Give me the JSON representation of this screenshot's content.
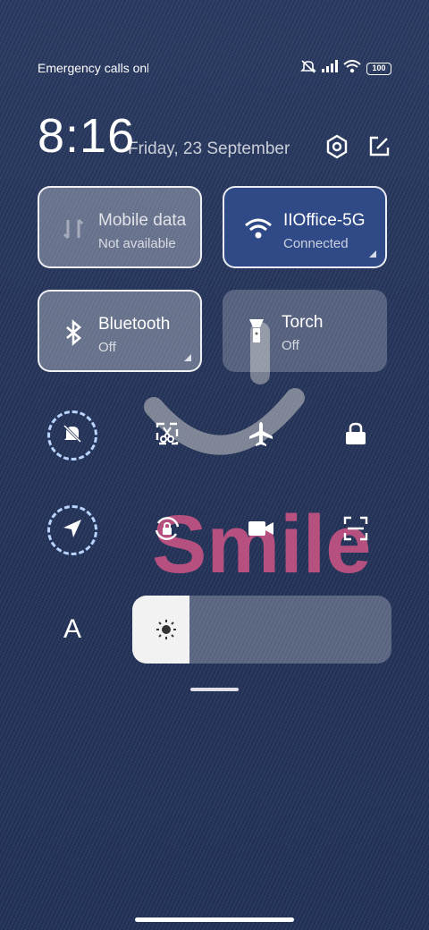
{
  "status_bar": {
    "carrier_text": "Emergency calls only",
    "battery_level": "100",
    "icons": [
      "silent-icon",
      "signal-icon",
      "wifi-icon",
      "battery-icon"
    ]
  },
  "header": {
    "time": "8:16",
    "date": "Friday, 23 September",
    "icons": [
      "settings-icon",
      "edit-icon"
    ]
  },
  "tiles": [
    {
      "name": "Mobile data",
      "status": "Not available",
      "icon": "mobile-data-icon",
      "active": false
    },
    {
      "name": "IIOffice-5G",
      "status": "Connected",
      "icon": "wifi-icon",
      "active": true
    },
    {
      "name": "Bluetooth",
      "status": "Off",
      "icon": "bluetooth-icon",
      "active": false
    },
    {
      "name": "Torch",
      "status": "Off",
      "icon": "torch-icon",
      "active": false
    }
  ],
  "quick_toggles_row1": [
    "silent-mode-icon",
    "screenshot-icon",
    "airplane-icon",
    "lock-icon"
  ],
  "quick_toggles_row2": [
    "location-icon",
    "rotation-lock-icon",
    "screen-record-icon",
    "scanner-icon"
  ],
  "brightness": {
    "level": 0.22,
    "icon": "sun-icon"
  },
  "auto_brightness_label": "A",
  "wallpaper_text": "Smile",
  "colors": {
    "active_tile": "#2f4a86",
    "dashed_ring": "#b9d4ff",
    "bg": "#24345b"
  }
}
